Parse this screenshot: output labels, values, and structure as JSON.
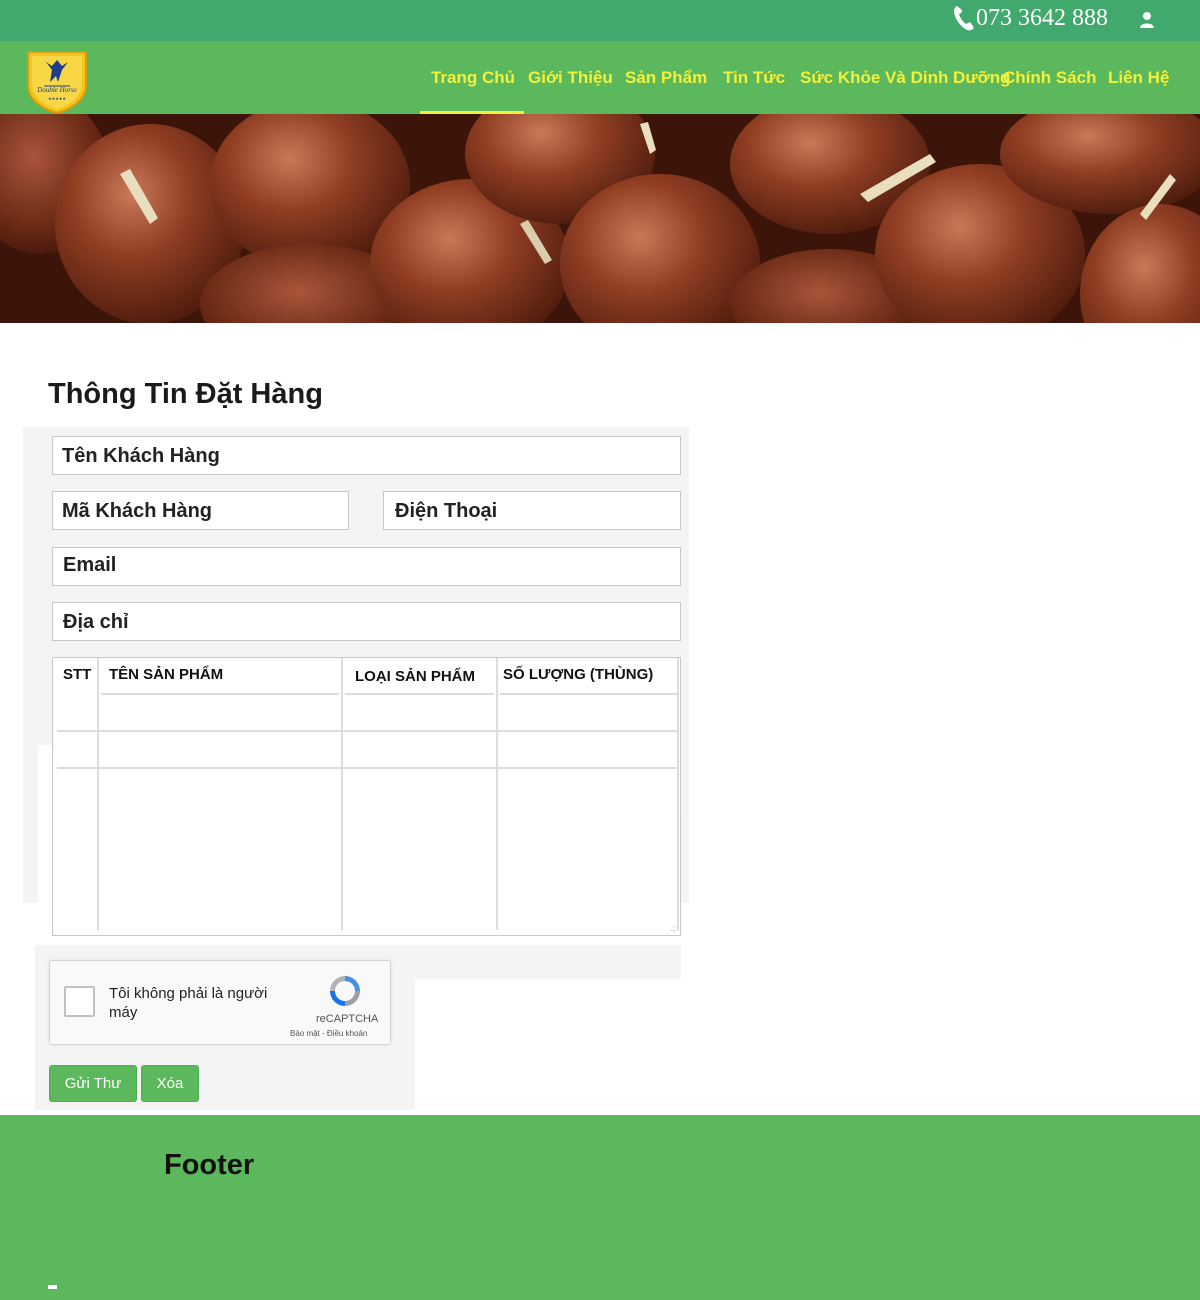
{
  "topbar": {
    "phone": "073 3642 888",
    "phone_icon": "phone-icon",
    "user_icon": "user-icon"
  },
  "logo": {
    "text": "Double Horse",
    "stars": "★★★★★"
  },
  "nav": {
    "items": [
      {
        "label": "Trang Chủ",
        "active": true
      },
      {
        "label": "Giới Thiệu"
      },
      {
        "label": "Sản Phẩm"
      },
      {
        "label": "Tin Tức"
      },
      {
        "label": "Sức Khỏe Và Dinh Dưỡng"
      },
      {
        "label": "Chính Sách"
      },
      {
        "label": "Liên Hệ"
      }
    ],
    "text_color": "#f4f13a",
    "bar_color": "#5cb85c"
  },
  "form": {
    "title": "Thông Tin Đặt Hàng",
    "customer_name": "Tên Khách Hàng",
    "customer_code": "Mã Khách Hàng",
    "phone": "Điện Thoại",
    "email": "Email",
    "address": "Địa chỉ",
    "table_headers": [
      "STT",
      "TÊN SẢN PHẨM",
      "LOẠI SẢN PHẨM",
      "SỐ LƯỢNG (THÙNG)"
    ]
  },
  "captcha": {
    "label": "Tôi không phải là người máy",
    "brand": "reCAPTCHA",
    "links": "Bảo mật - Điều khoản"
  },
  "buttons": {
    "submit": "Gửi Thư",
    "clear": "Xóa"
  },
  "footer": {
    "title": "Footer"
  },
  "colors": {
    "topbar": "#41a96e",
    "accent_green": "#5cb85c"
  }
}
